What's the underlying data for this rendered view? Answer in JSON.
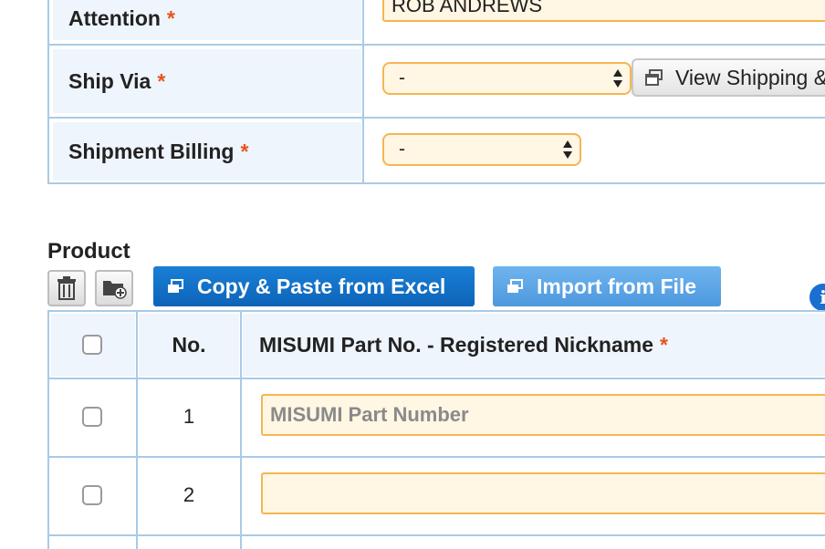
{
  "shipping_form": {
    "attention": {
      "label": "Attention",
      "required_mark": "*",
      "value": "ROB ANDREWS"
    },
    "ship_via": {
      "label": "Ship Via",
      "required_mark": "*",
      "selected": "-",
      "view_button_label": "View Shipping &"
    },
    "shipment_billing": {
      "label": "Shipment Billing",
      "required_mark": "*",
      "selected": "-"
    }
  },
  "product": {
    "title": "Product",
    "toolbar": {
      "delete_icon": "trash-icon",
      "add_folder_icon": "folder-add-icon",
      "copy_paste_label": "Copy & Paste from Excel",
      "import_label": "Import from File",
      "window_icon": "popup-window-icon",
      "info_glyph": "i"
    },
    "table": {
      "headers": {
        "no": "No.",
        "part_number": "MISUMI Part No. - Registered Nickname",
        "part_required_mark": "*"
      },
      "rows": [
        {
          "no": "1",
          "part_value": "",
          "part_placeholder": "MISUMI Part Number"
        },
        {
          "no": "2",
          "part_value": "",
          "part_placeholder": ""
        }
      ]
    }
  },
  "colors": {
    "accent_blue": "#0d64b8",
    "light_blue_button": "#4d98de",
    "border_blue": "#a9cbe6",
    "label_bg": "#eef5fc",
    "input_bg": "#fff6e3",
    "input_border": "#f5b553",
    "required": "#e8541c"
  }
}
